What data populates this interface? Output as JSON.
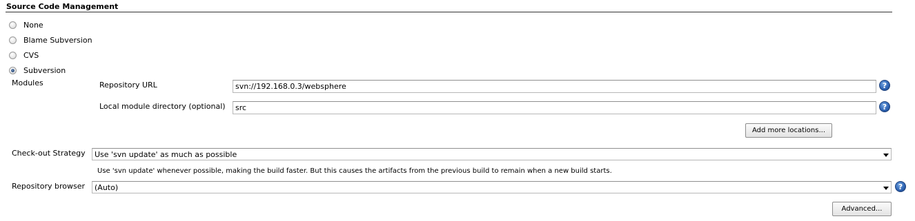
{
  "section": {
    "title": "Source Code Management"
  },
  "scm_options": [
    {
      "label": "None",
      "selected": false
    },
    {
      "label": "Blame Subversion",
      "selected": false
    },
    {
      "label": "CVS",
      "selected": false
    },
    {
      "label": "Subversion",
      "selected": true
    }
  ],
  "modules": {
    "label": "Modules",
    "repository_url_label": "Repository URL",
    "repository_url_value": "svn://192.168.0.3/websphere",
    "local_dir_label": "Local module directory (optional)",
    "local_dir_value": "src",
    "add_locations_button": "Add more locations..."
  },
  "checkout": {
    "label": "Check-out Strategy",
    "selected": "Use 'svn update' as much as possible",
    "description": "Use 'svn update' whenever possible, making the build faster. But this causes the artifacts from the previous build to remain when a new build starts."
  },
  "repo_browser": {
    "label": "Repository browser",
    "selected": "(Auto)"
  },
  "advanced_button": "Advanced...",
  "help_glyph": "?",
  "icons": {
    "help": "help-icon",
    "caret": "chevron-down-icon",
    "radio": "radio-icon"
  },
  "colors": {
    "help_icon": "#2d62b2",
    "rule": "#333333"
  }
}
